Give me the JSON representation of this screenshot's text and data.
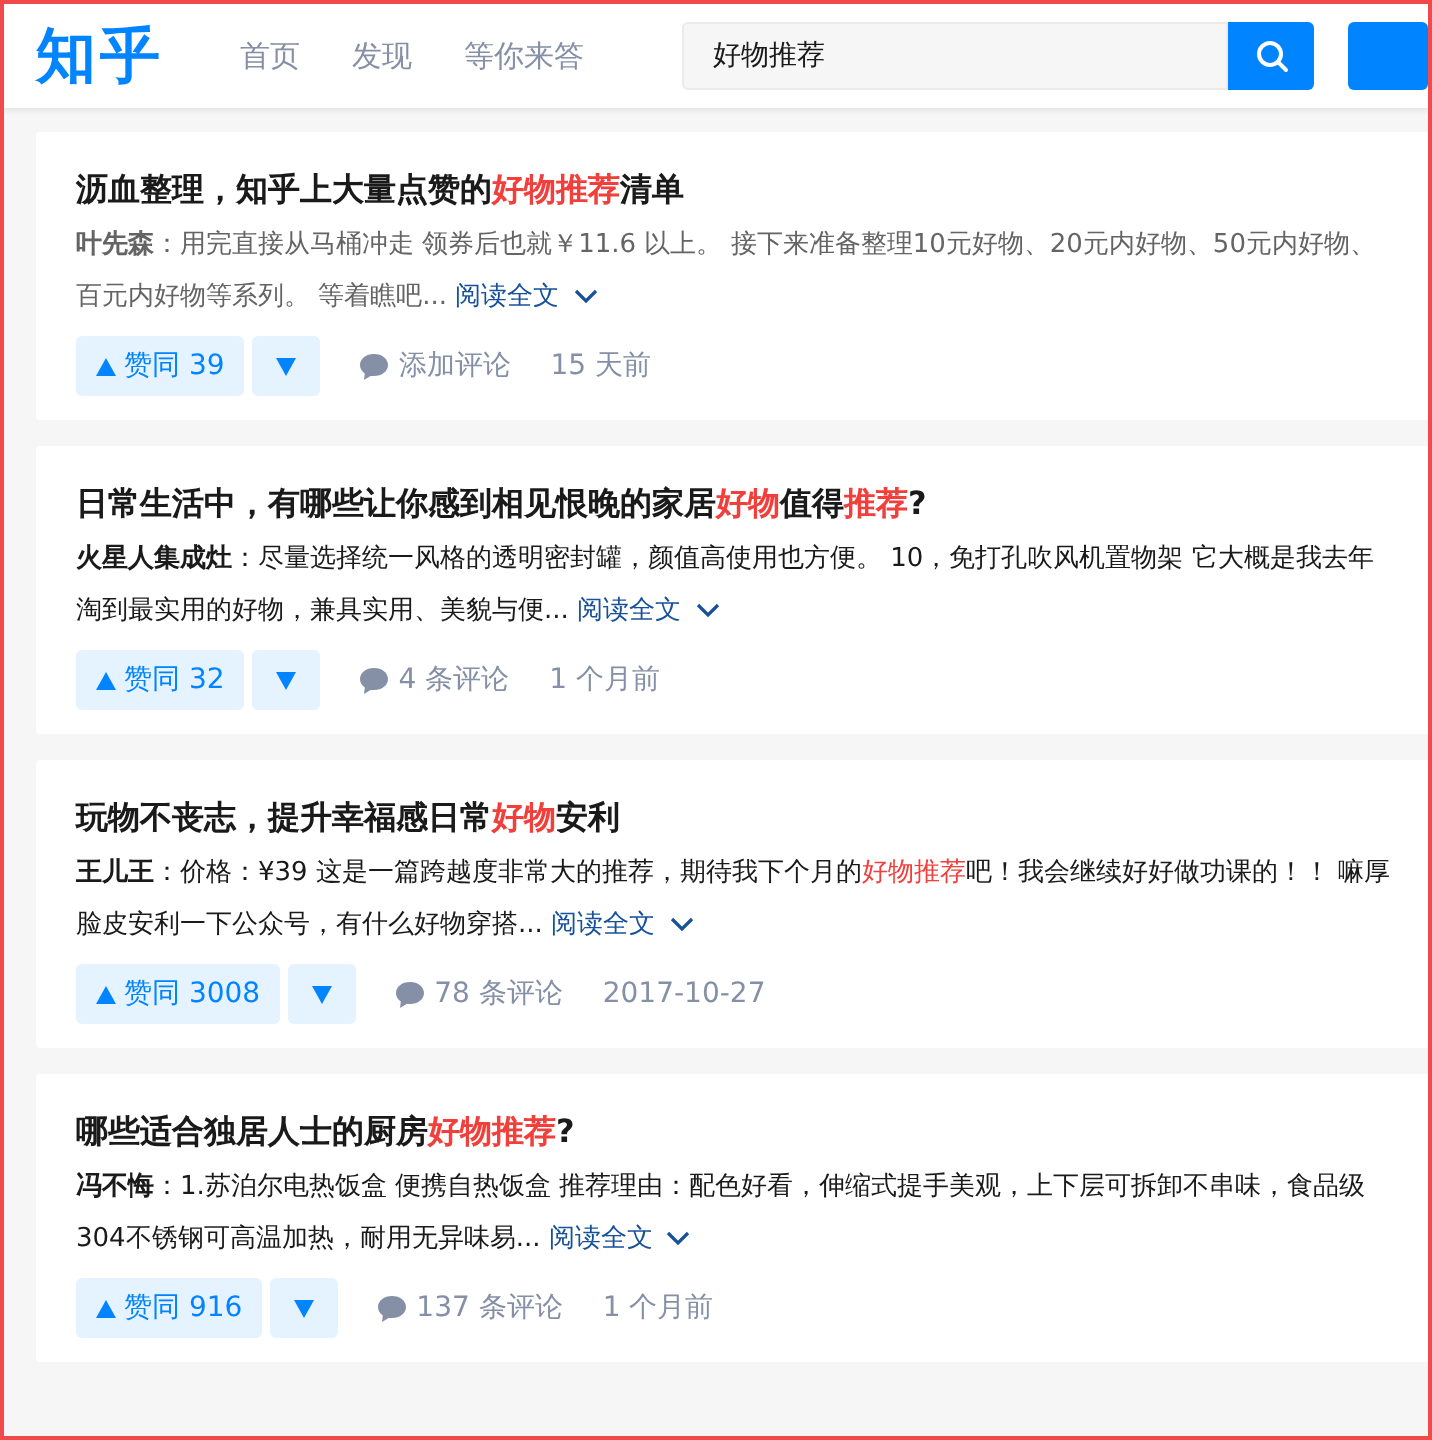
{
  "header": {
    "logo": "知乎",
    "nav": [
      {
        "label": "首页"
      },
      {
        "label": "发现"
      },
      {
        "label": "等你来答"
      }
    ],
    "search": {
      "value": "好物推荐"
    }
  },
  "results": [
    {
      "title": [
        {
          "text": "沥血整理，知乎上大量点赞的",
          "highlight": false
        },
        {
          "text": "好物推荐",
          "highlight": true
        },
        {
          "text": "清单",
          "highlight": false
        }
      ],
      "author": "叶先森",
      "read": true,
      "excerpt": [
        {
          "text": "：用完直接从马桶冲走 领券后也就￥11.6 以上。 接下来准备整理10元好物、20元内好物、50元内好物、百元内好物等系列。 等着瞧吧...",
          "highlight": false
        }
      ],
      "read_more": "阅读全文",
      "votes": "赞同 39",
      "comments": "添加评论",
      "time": "15 天前"
    },
    {
      "title": [
        {
          "text": "日常生活中，有哪些让你感到相见恨晚的家居",
          "highlight": false
        },
        {
          "text": "好物",
          "highlight": true
        },
        {
          "text": "值得",
          "highlight": false
        },
        {
          "text": "推荐",
          "highlight": true
        },
        {
          "text": "?",
          "highlight": false
        }
      ],
      "author": "火星人集成灶",
      "read": false,
      "excerpt": [
        {
          "text": "：尽量选择统一风格的透明密封罐，颜值高使用也方便。 10，免打孔吹风机置物架 它大概是我去年淘到最实用的好物，兼具实用、美貌与便...",
          "highlight": false
        }
      ],
      "read_more": "阅读全文",
      "votes": "赞同 32",
      "comments": "4 条评论",
      "time": "1 个月前"
    },
    {
      "title": [
        {
          "text": "玩物不丧志，提升幸福感日常",
          "highlight": false
        },
        {
          "text": "好物",
          "highlight": true
        },
        {
          "text": "安利",
          "highlight": false
        }
      ],
      "author": "王儿王",
      "read": false,
      "excerpt": [
        {
          "text": "：价格：¥39 这是一篇跨越度非常大的推荐，期待我下个月的",
          "highlight": false
        },
        {
          "text": "好物推荐",
          "highlight": true
        },
        {
          "text": "吧！我会继续好好做功课的！！ 嘛厚脸皮安利一下公众号，有什么好物穿搭...",
          "highlight": false
        }
      ],
      "read_more": "阅读全文",
      "votes": "赞同 3008",
      "comments": "78 条评论",
      "time": "2017-10-27"
    },
    {
      "title": [
        {
          "text": "哪些适合独居人士的厨房",
          "highlight": false
        },
        {
          "text": "好物推荐",
          "highlight": true
        },
        {
          "text": "?",
          "highlight": false
        }
      ],
      "author": "冯不悔",
      "read": false,
      "excerpt": [
        {
          "text": "：1.苏泊尔电热饭盒 便携自热饭盒 推荐理由：配色好看，伸缩式提手美观，上下层可拆卸不串味，食品级304不锈钢可高温加热，耐用无异味易...",
          "highlight": false
        }
      ],
      "read_more": "阅读全文",
      "votes": "赞同 916",
      "comments": "137 条评论",
      "time": "1 个月前"
    }
  ]
}
